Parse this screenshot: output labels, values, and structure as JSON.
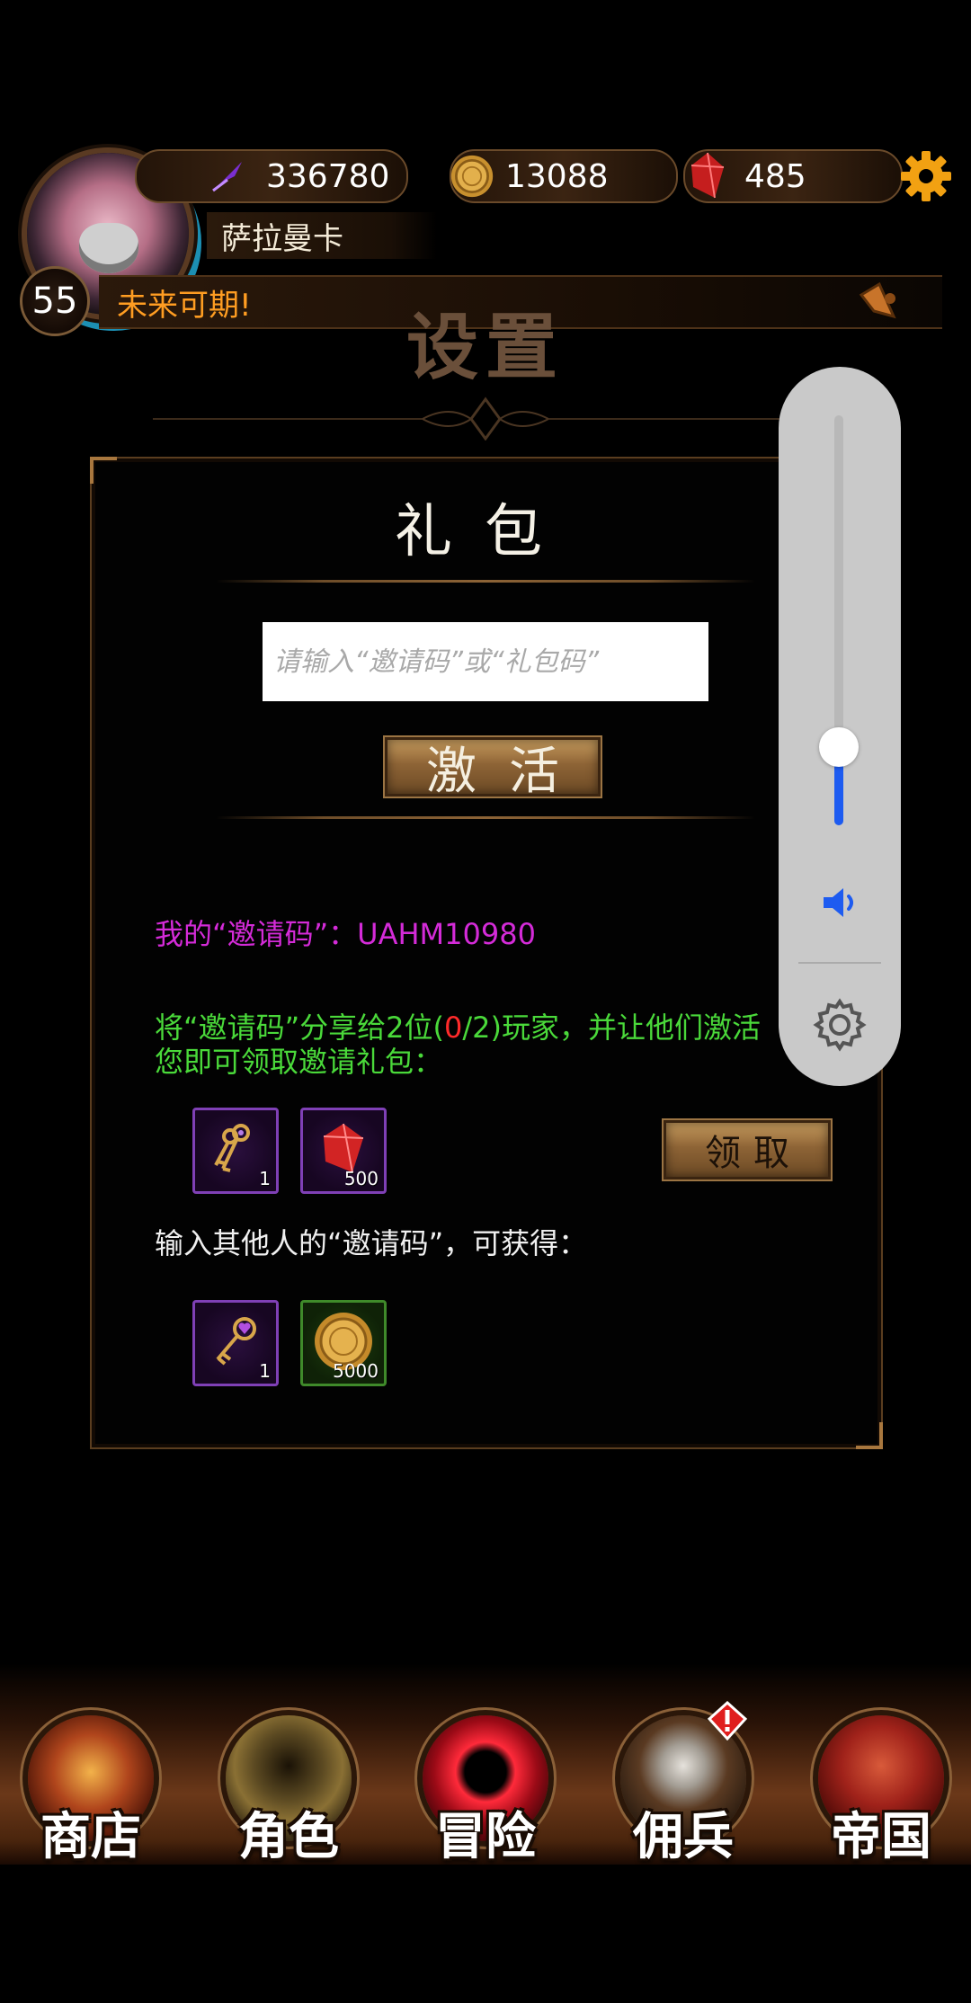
{
  "header": {
    "exp_value": "336780",
    "gold_value": "13088",
    "gem_value": "485",
    "player_name": "萨拉曼卡",
    "level": "55",
    "notice_text": "未来可期!"
  },
  "page": {
    "title": "设置"
  },
  "gift_panel": {
    "title": "礼包",
    "code_input_placeholder": "请输入“邀请码”或“礼包码”",
    "code_input_value": "",
    "activate_label": "激活",
    "my_code_text": "我的“邀请码”：UAHM10980",
    "share_text_before": "将“邀请码”分享给2位(",
    "share_progress": "0",
    "share_text_after": "/2)玩家，并让他们激活",
    "share_text_line2": "您即可领取邀请礼包：",
    "claim_label": "领取",
    "invite_rewards": [
      {
        "icon": "keys-bundle-icon",
        "count": "1"
      },
      {
        "icon": "red-gem-icon",
        "count": "500"
      }
    ],
    "input_others_text": "输入其他人的“邀请码”，可获得：",
    "input_rewards": [
      {
        "icon": "heart-key-icon",
        "count": "1"
      },
      {
        "icon": "gold-coin-icon",
        "count": "5000"
      }
    ]
  },
  "volume_overlay": {
    "level_fraction": 0.19
  },
  "bottom_nav": [
    {
      "label": "商店",
      "icon": "shop-castle-icon"
    },
    {
      "label": "角色",
      "icon": "hooded-figure-icon"
    },
    {
      "label": "冒险",
      "icon": "red-portal-icon"
    },
    {
      "label": "佣兵",
      "icon": "mercenary-cards-icon",
      "alert": true
    },
    {
      "label": "帝国",
      "icon": "empire-banner-icon"
    }
  ],
  "colors": {
    "my_code": "#d42bd8",
    "share_text": "#4ad93a",
    "share_progress": "#ff2a2a",
    "notice": "#ff9d22",
    "volume_fill": "#1d5bf0"
  }
}
